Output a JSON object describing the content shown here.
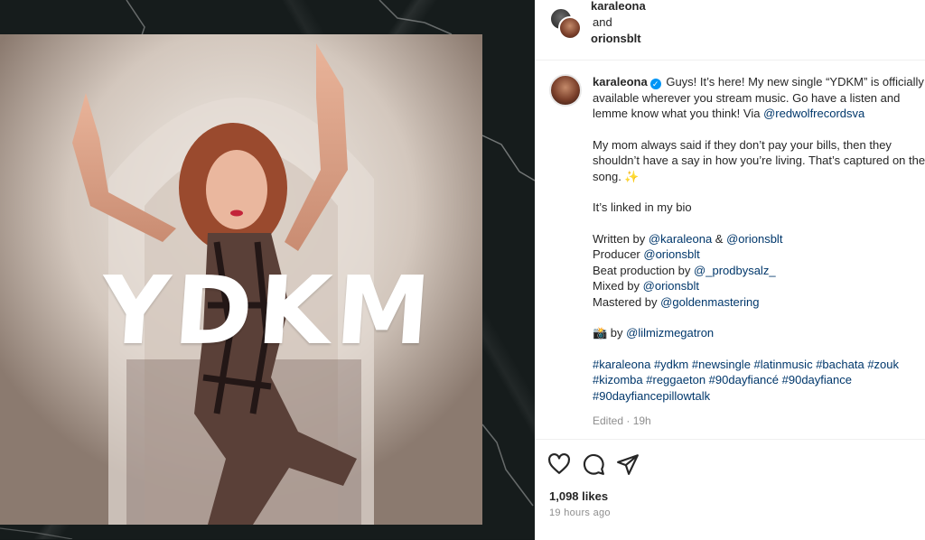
{
  "post": {
    "image_text": "YDKM"
  },
  "header": {
    "user1": "karaleona",
    "and_text": "and",
    "user2": "orionsblt"
  },
  "caption": {
    "username": "karaleona",
    "verified_glyph": "✓",
    "p1_a": "Guys! It’s here! My new single “YDKM” is officially",
    "p1_b": "available wherever you stream music. Go have a listen and",
    "p1_c": "lemme know what you think! Via ",
    "p1_mention": "@redwolfrecordsva",
    "p2_a": "My mom always said if they don’t pay your bills, then they",
    "p2_b": "shouldn’t have a say in how you’re living. That’s captured on the",
    "p2_c": "song. ✨",
    "p3": "It’s linked in my bio",
    "written_by": "Written by ",
    "written_m1": "@karaleona",
    "written_amp": " & ",
    "written_m2": "@orionsblt",
    "producer": "Producer ",
    "producer_m": "@orionsblt",
    "beat": "Beat production by ",
    "beat_m": "@_prodbysalz_",
    "mixed": "Mixed by ",
    "mixed_m": "@orionsblt",
    "mastered": "Mastered by ",
    "mastered_m": "@goldenmastering",
    "photo_emoji": "📸",
    "photo_by": " by ",
    "photo_m": "@lilmizmegatron",
    "hashtags_l1": [
      "#karaleona",
      "#ydkm",
      "#newsingle",
      "#latinmusic",
      "#bachata",
      "#zouk"
    ],
    "hashtags_l2": [
      "#kizomba",
      "#reggaeton",
      "#90dayfiancé",
      "#90dayfiance"
    ],
    "hashtags_l3": [
      "#90dayfiancepillowtalk"
    ],
    "edited": "Edited · 19h"
  },
  "actions": {
    "like_icon": "heart-icon",
    "comment_icon": "comment-icon",
    "share_icon": "share-icon"
  },
  "stats": {
    "likes": "1,098 likes",
    "time": "19 hours ago"
  },
  "colors": {
    "link": "#00376b",
    "verified": "#0095f6",
    "muted": "#8e8e8e"
  }
}
